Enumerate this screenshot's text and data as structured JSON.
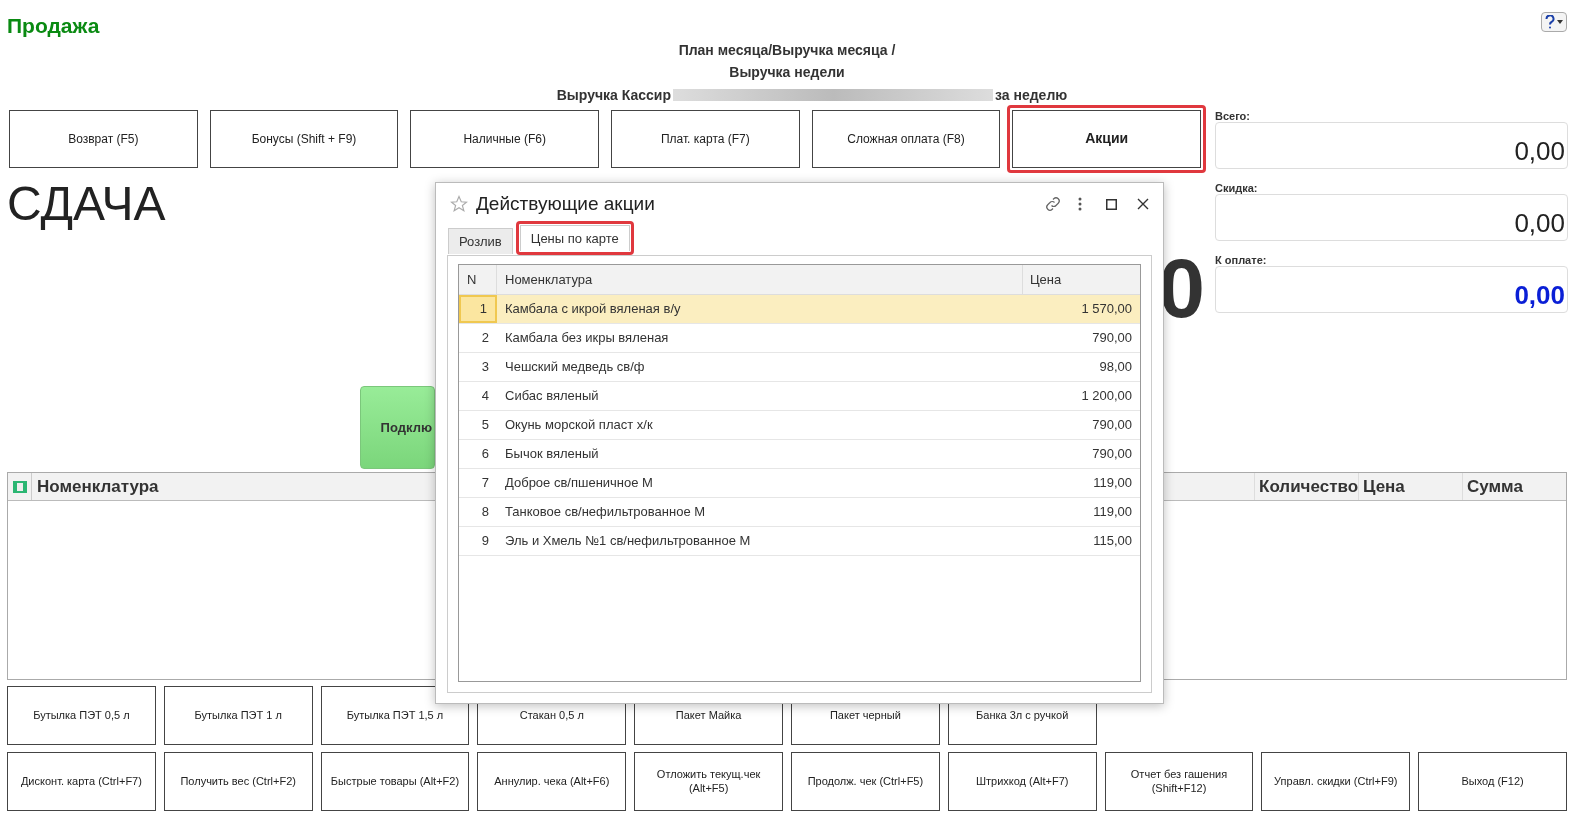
{
  "title": "Продажа",
  "header_lines": [
    "План месяца/Выручка месяца  /",
    "Выручка недели"
  ],
  "cashier": {
    "prefix": "Выручка Кассир",
    "suffix": "за неделю"
  },
  "top_buttons": [
    {
      "label": "Возврат (F5)",
      "highlighted": false
    },
    {
      "label": "Бонусы (Shift + F9)",
      "highlighted": false
    },
    {
      "label": "Наличные (F6)",
      "highlighted": false
    },
    {
      "label": "Плат. карта (F7)",
      "highlighted": false
    },
    {
      "label": "Сложная оплата (F8)",
      "highlighted": false
    },
    {
      "label": "Акции",
      "highlighted": true
    }
  ],
  "change": {
    "label": "СДАЧА",
    "value": "0"
  },
  "connect_button": "Подклю",
  "totals": [
    {
      "label": "Всего:",
      "value": "0,00",
      "kind": "normal"
    },
    {
      "label": "Скидка:",
      "value": "0,00",
      "kind": "normal"
    },
    {
      "label": "К оплате:",
      "value": "0,00",
      "kind": "due"
    }
  ],
  "table": {
    "columns": [
      {
        "label": "Номенклатура",
        "kind": "icon"
      },
      {
        "label": "Количество",
        "kind": "plain"
      },
      {
        "label": "Цена",
        "kind": "plain"
      },
      {
        "label": "Сумма",
        "kind": "plain"
      }
    ]
  },
  "goods_buttons": [
    "Бутылка ПЭТ 0,5 л",
    "Бутылка ПЭТ 1 л",
    "Бутылка ПЭТ 1,5 л",
    "Стакан 0,5 л",
    "Пакет Майка",
    "Пакет черный",
    "Банка 3л с ручкой"
  ],
  "function_buttons": [
    "Дисконт. карта (Ctrl+F7)",
    "Получить вес (Ctrl+F2)",
    "Быстрые товары (Alt+F2)",
    "Аннулир. чека (Alt+F6)",
    "Отложить текущ.чек (Alt+F5)",
    "Продолж. чек (Ctrl+F5)",
    "Штрихкод (Alt+F7)",
    "Отчет без гашения (Shift+F12)",
    "Управл. скидки (Ctrl+F9)",
    "Выход (F12)"
  ],
  "dialog": {
    "title": "Действующие акции",
    "tabs": [
      {
        "label": "Розлив",
        "selected": false,
        "highlighted": false
      },
      {
        "label": "Цены по карте",
        "selected": true,
        "highlighted": true
      }
    ],
    "columns": [
      "N",
      "Номенклатура",
      "Цена"
    ],
    "rows": [
      {
        "n": "1",
        "name": "Камбала с икрой вяленая в/у",
        "price": "1 570,00",
        "selected": true
      },
      {
        "n": "2",
        "name": "Камбала без икры вяленая",
        "price": "790,00",
        "selected": false
      },
      {
        "n": "3",
        "name": "Чешский медведь св/ф",
        "price": "98,00",
        "selected": false
      },
      {
        "n": "4",
        "name": "Сибас вяленый",
        "price": "1 200,00",
        "selected": false
      },
      {
        "n": "5",
        "name": "Окунь морской пласт х/к",
        "price": "790,00",
        "selected": false
      },
      {
        "n": "6",
        "name": "Бычок вяленый",
        "price": "790,00",
        "selected": false
      },
      {
        "n": "7",
        "name": "Доброе св/пшеничное М",
        "price": "119,00",
        "selected": false
      },
      {
        "n": "8",
        "name": "Танковое св/нефильтрованное М",
        "price": "119,00",
        "selected": false
      },
      {
        "n": "9",
        "name": "Эль и Хмель №1 св/нефильтрованное М",
        "price": "115,00",
        "selected": false
      }
    ]
  }
}
